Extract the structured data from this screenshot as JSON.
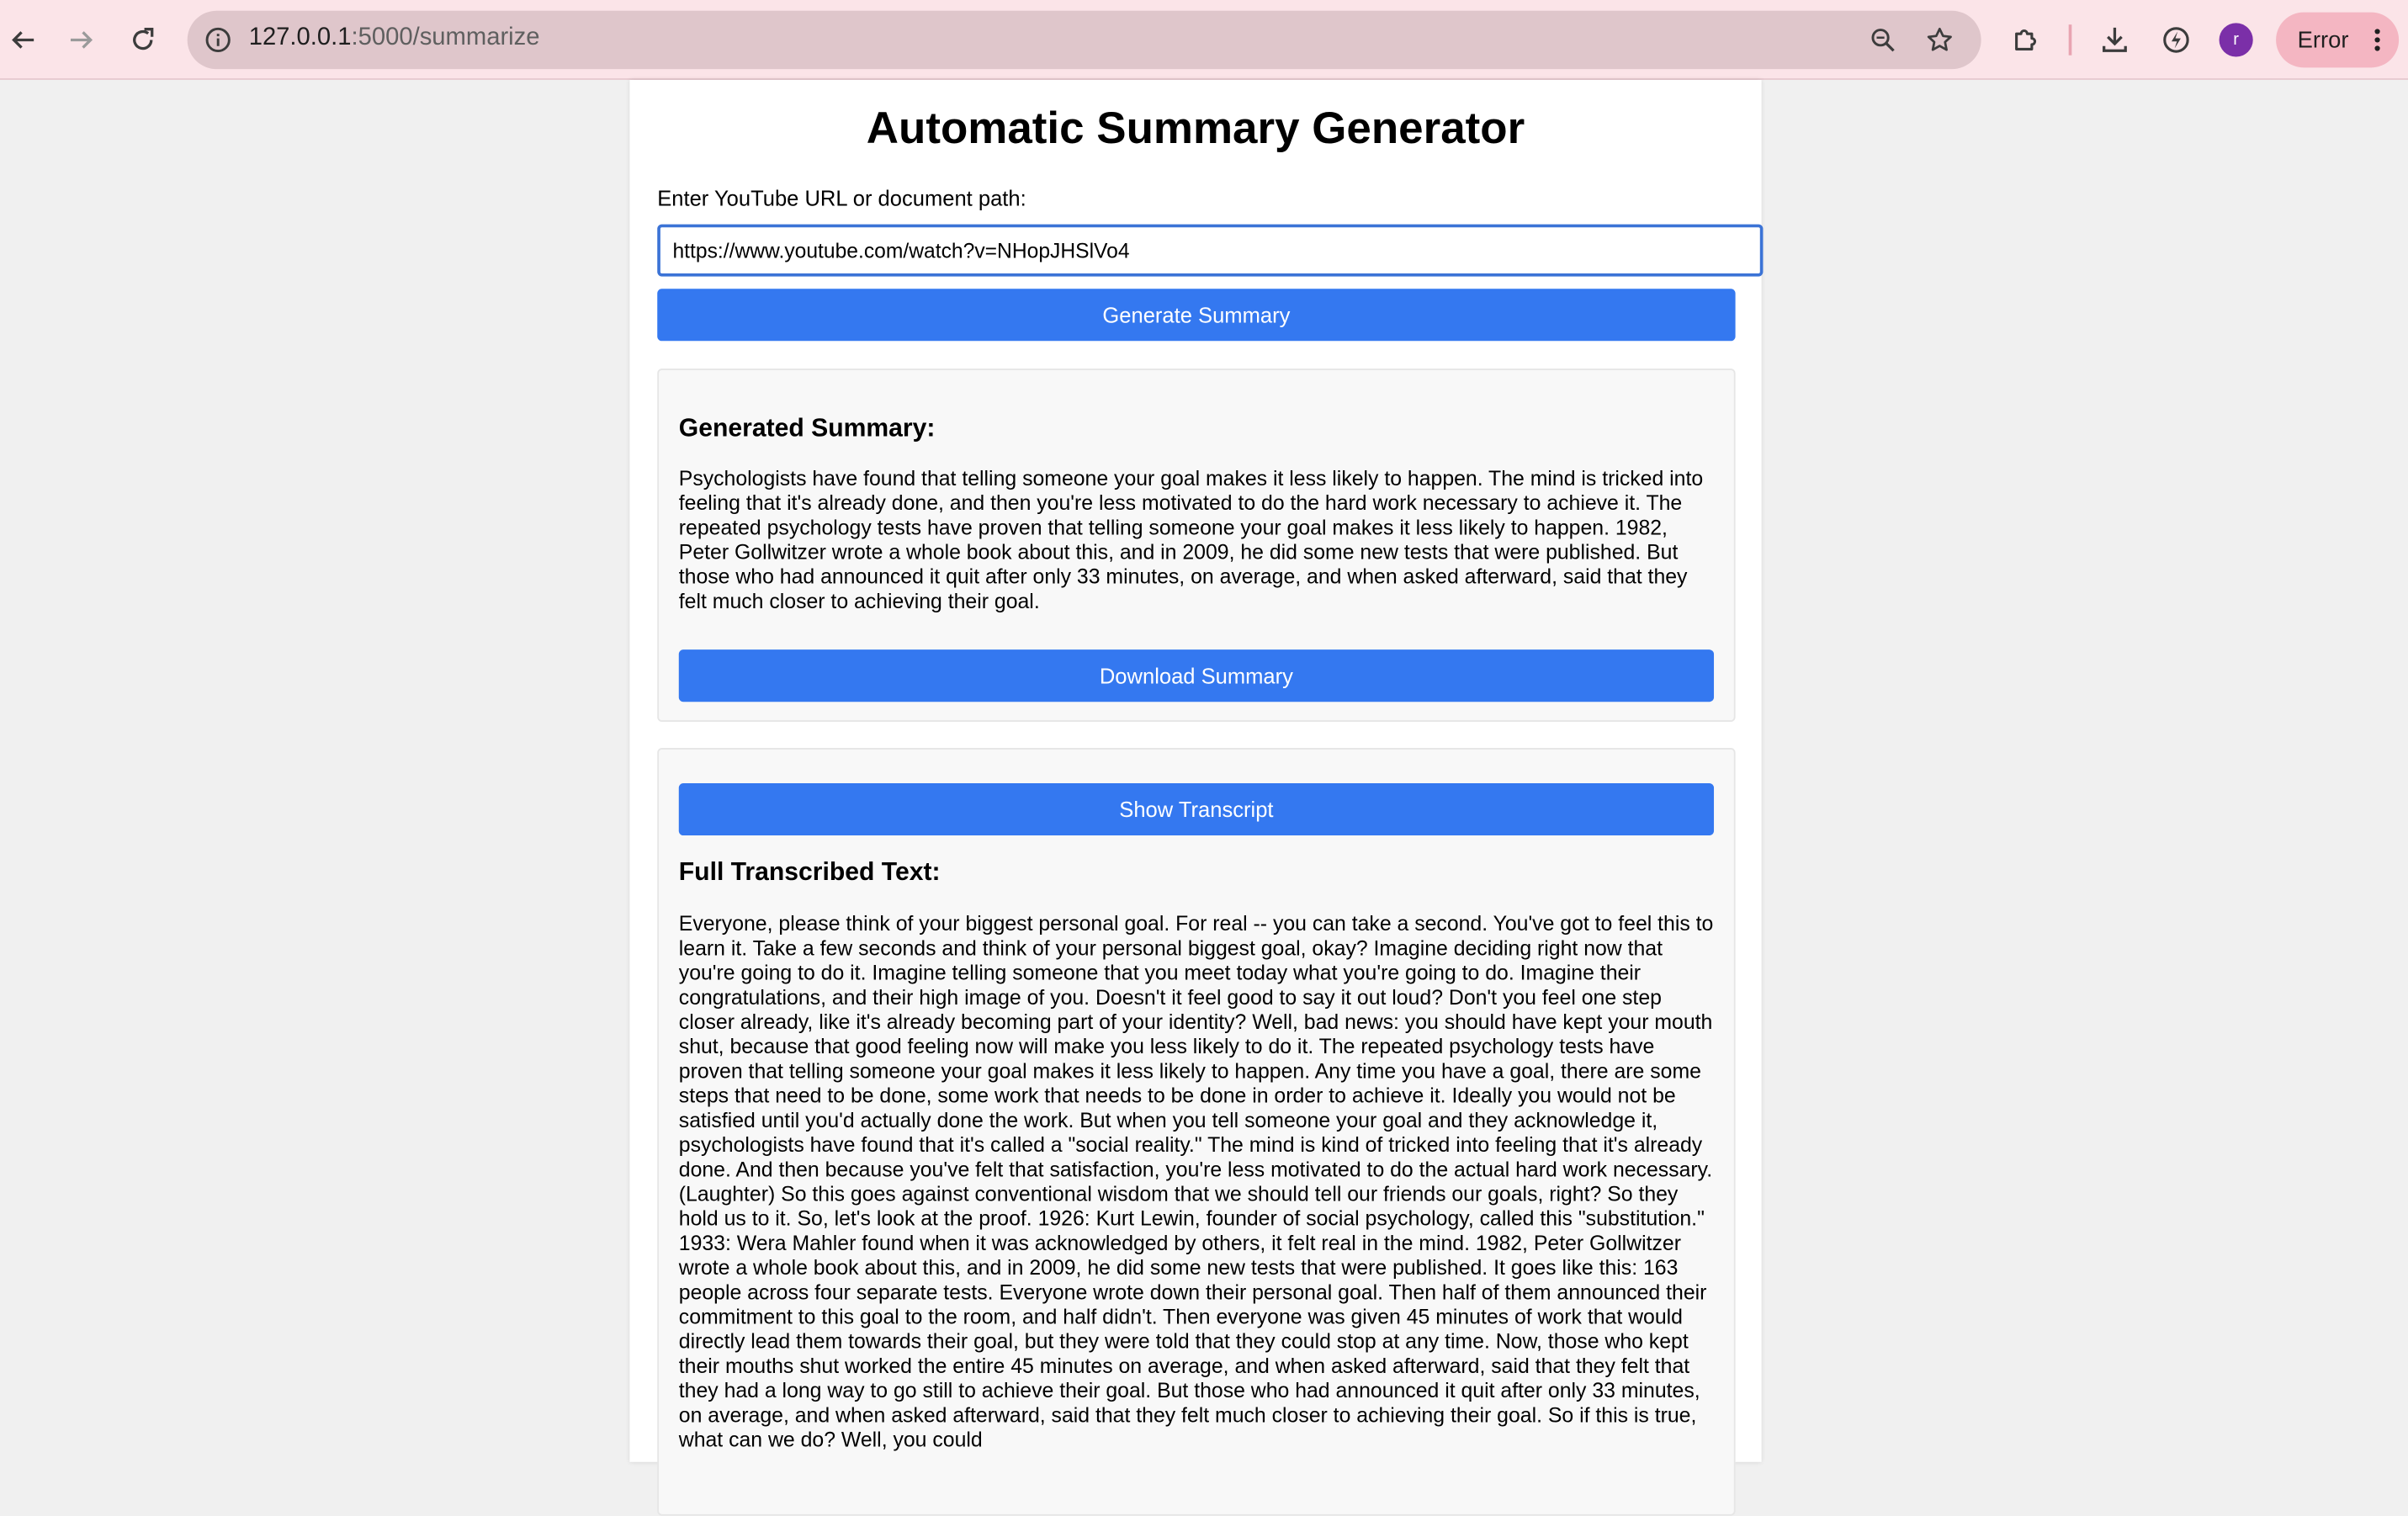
{
  "browser": {
    "url_host": "127.0.0.1",
    "url_path": ":5000/summarize",
    "avatar_letter": "r",
    "status_chip": "Error"
  },
  "page": {
    "title": "Automatic Summary Generator",
    "input_label": "Enter YouTube URL or document path:",
    "input_value": "https://www.youtube.com/watch?v=NHopJHSlVo4",
    "generate_button": "Generate Summary",
    "summary_heading": "Generated Summary:",
    "summary_text": "Psychologists have found that telling someone your goal makes it less likely to happen. The mind is tricked into feeling that it's already done, and then you're less motivated to do the hard work necessary to achieve it. The repeated psychology tests have proven that telling someone your goal makes it less likely to happen. 1982, Peter Gollwitzer wrote a whole book about this, and in 2009, he did some new tests that were published. But those who had announced it quit after only 33 minutes, on average, and when asked afterward, said that they felt much closer to achieving their goal.",
    "download_button": "Download Summary",
    "show_transcript_button": "Show Transcript",
    "transcript_heading": "Full Transcribed Text:",
    "transcript_text": "Everyone, please think of your biggest personal goal. For real -- you can take a second. You've got to feel this to learn it. Take a few seconds and think of your personal biggest goal, okay? Imagine deciding right now that you're going to do it. Imagine telling someone that you meet today what you're going to do. Imagine their congratulations, and their high image of you. Doesn't it feel good to say it out loud? Don't you feel one step closer already, like it's already becoming part of your identity? Well, bad news: you should have kept your mouth shut, because that good feeling now will make you less likely to do it. The repeated psychology tests have proven that telling someone your goal makes it less likely to happen. Any time you have a goal, there are some steps that need to be done, some work that needs to be done in order to achieve it. Ideally you would not be satisfied until you'd actually done the work. But when you tell someone your goal and they acknowledge it, psychologists have found that it's called a \"social reality.\" The mind is kind of tricked into feeling that it's already done. And then because you've felt that satisfaction, you're less motivated to do the actual hard work necessary. (Laughter) So this goes against conventional wisdom that we should tell our friends our goals, right? So they hold us to it. So, let's look at the proof. 1926: Kurt Lewin, founder of social psychology, called this \"substitution.\" 1933: Wera Mahler found when it was acknowledged by others, it felt real in the mind. 1982, Peter Gollwitzer wrote a whole book about this, and in 2009, he did some new tests that were published. It goes like this: 163 people across four separate tests. Everyone wrote down their personal goal. Then half of them announced their commitment to this goal to the room, and half didn't. Then everyone was given 45 minutes of work that would directly lead them towards their goal, but they were told that they could stop at any time. Now, those who kept their mouths shut worked the entire 45 minutes on average, and when asked afterward, said that they felt that they had a long way to go still to achieve their goal. But those who had announced it quit after only 33 minutes, on average, and when asked afterward, said that they felt much closer to achieving their goal. So if this is true, what can we do? Well, you could"
  }
}
